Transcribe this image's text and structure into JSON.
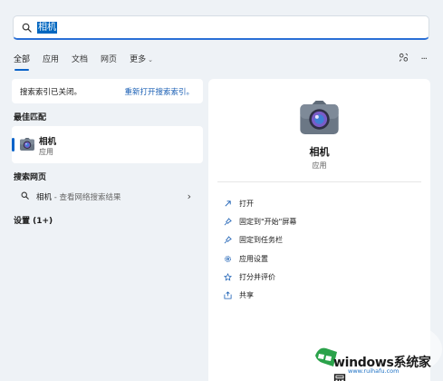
{
  "search": {
    "value": "相机"
  },
  "tabs": [
    {
      "label": "全部",
      "active": true
    },
    {
      "label": "应用"
    },
    {
      "label": "文档"
    },
    {
      "label": "网页"
    },
    {
      "label": "更多"
    }
  ],
  "top_actions": {
    "share_icon": "share-icon",
    "more_label": "···"
  },
  "notice": {
    "text": "搜索索引已关闭。",
    "link": "重新打开搜索索引。"
  },
  "best_match": {
    "heading": "最佳匹配",
    "name": "相机",
    "type": "应用"
  },
  "web_search": {
    "heading": "搜索网页",
    "query": "相机",
    "suffix": " - 查看网络搜索结果"
  },
  "settings": {
    "heading": "设置 (1+)"
  },
  "right_panel": {
    "name": "相机",
    "type": "应用",
    "actions": [
      {
        "label": "打开",
        "icon": "open-icon"
      },
      {
        "label": "固定到\"开始\"屏幕",
        "icon": "pin-icon"
      },
      {
        "label": "固定到任务栏",
        "icon": "pin-icon"
      },
      {
        "label": "应用设置",
        "icon": "gear-icon"
      },
      {
        "label": "打分并评价",
        "icon": "star-icon"
      },
      {
        "label": "共享",
        "icon": "share-icon"
      }
    ]
  },
  "watermark": {
    "text": "windows系统家园",
    "url": "www.ruihafu.com"
  },
  "colors": {
    "accent": "#0a63c9",
    "background": "#eef2f6",
    "link": "#1a5fb4"
  }
}
